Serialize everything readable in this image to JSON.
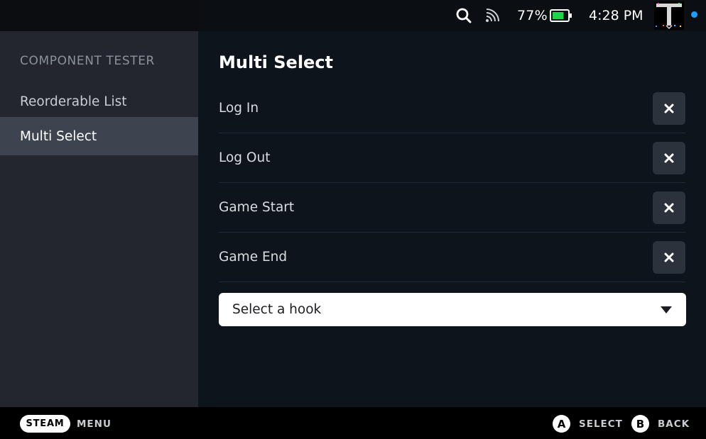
{
  "status_bar": {
    "battery_percent": "77%",
    "battery_level": 0.77,
    "time": "4:28 PM",
    "icons": [
      "search-icon",
      "cast-icon",
      "battery-icon",
      "avatar",
      "notification-dot"
    ]
  },
  "sidebar": {
    "title": "COMPONENT TESTER",
    "items": [
      {
        "label": "Reorderable List",
        "active": false
      },
      {
        "label": "Multi Select",
        "active": true
      }
    ]
  },
  "main": {
    "title": "Multi Select",
    "rows": [
      {
        "label": "Log In",
        "action_icon": "close-icon"
      },
      {
        "label": "Log Out",
        "action_icon": "close-icon"
      },
      {
        "label": "Game Start",
        "action_icon": "close-icon"
      },
      {
        "label": "Game End",
        "action_icon": "close-icon"
      }
    ],
    "dropdown": {
      "placeholder": "Select a hook",
      "icon": "chevron-down-icon"
    }
  },
  "footer": {
    "steam_label": "STEAM",
    "menu_label": "MENU",
    "select_button": "A",
    "select_label": "SELECT",
    "back_button": "B",
    "back_label": "BACK"
  },
  "colors": {
    "accent_blue": "#1a9fff",
    "battery_green": "#1fd44b",
    "sidebar_active": "#3d4450",
    "background": "#0e141b"
  }
}
